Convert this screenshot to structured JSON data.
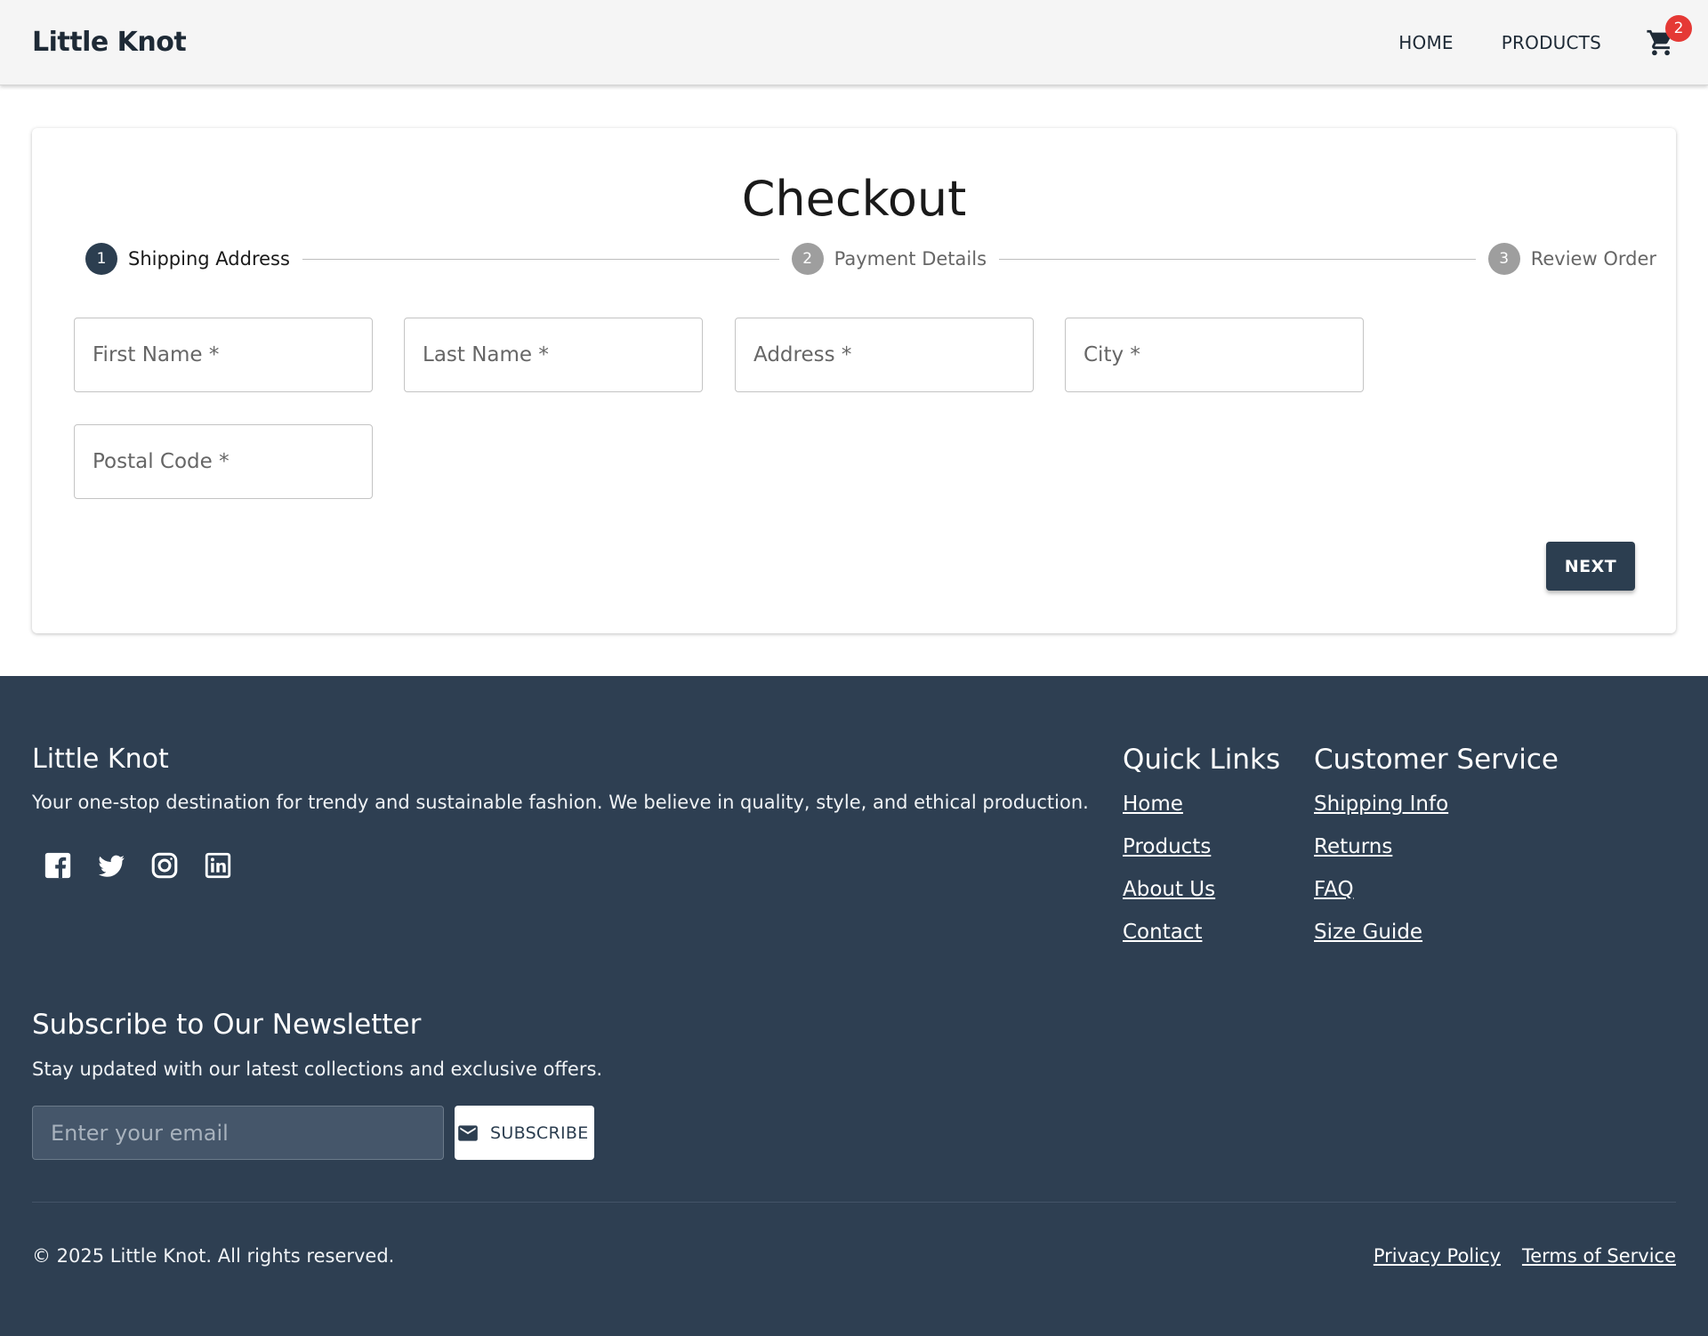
{
  "header": {
    "logo": "Little Knot",
    "nav": [
      "HOME",
      "PRODUCTS"
    ],
    "cart_icon": "shopping-cart-icon",
    "cart_count": "2"
  },
  "checkout": {
    "title": "Checkout",
    "steps": [
      {
        "number": "1",
        "label": "Shipping Address",
        "state": "active"
      },
      {
        "number": "2",
        "label": "Payment Details",
        "state": "inactive"
      },
      {
        "number": "3",
        "label": "Review Order",
        "state": "inactive"
      }
    ],
    "fields": {
      "first_name": {
        "placeholder": "First Name *",
        "value": ""
      },
      "last_name": {
        "placeholder": "Last Name *",
        "value": ""
      },
      "address": {
        "placeholder": "Address *",
        "value": ""
      },
      "city": {
        "placeholder": "City *",
        "value": ""
      },
      "postal_code": {
        "placeholder": "Postal Code *",
        "value": ""
      }
    },
    "next_label": "NEXT"
  },
  "footer": {
    "brand": "Little Knot",
    "description": "Your one-stop destination for trendy and sustainable fashion. We believe in quality, style, and ethical production.",
    "socials": [
      "facebook-icon",
      "twitter-icon",
      "instagram-icon",
      "linkedin-icon"
    ],
    "quick_links": {
      "title": "Quick Links",
      "links": [
        "Home",
        "Products",
        "About Us",
        "Contact"
      ]
    },
    "customer_service": {
      "title": "Customer Service",
      "links": [
        "Shipping Info",
        "Returns",
        "FAQ",
        "Size Guide"
      ]
    },
    "newsletter": {
      "title": "Subscribe to Our Newsletter",
      "description": "Stay updated with our latest collections and exclusive offers.",
      "email_placeholder": "Enter your email",
      "email_value": "",
      "button_label": "SUBSCRIBE",
      "button_icon": "mail-icon"
    },
    "copyright": "© 2025 Little Knot. All rights reserved.",
    "legal": [
      "Privacy Policy",
      "Terms of Service"
    ]
  },
  "colors": {
    "primary": "#2c3e50",
    "footer_bg": "#2e3f52",
    "badge": "#e53935",
    "step_inactive": "#9e9e9e",
    "header_bg": "#f5f5f5"
  }
}
